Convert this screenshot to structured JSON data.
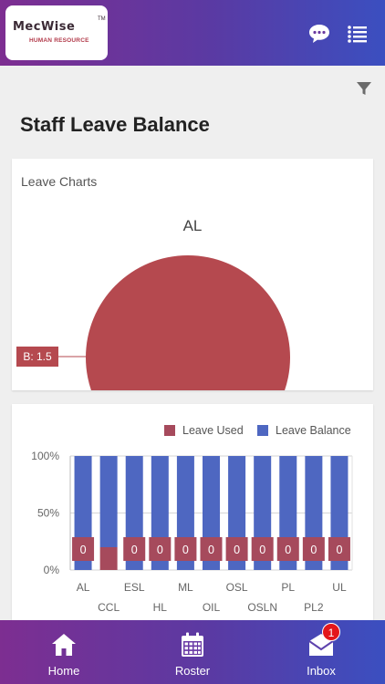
{
  "header": {
    "logo_name": "MecWise",
    "logo_tm": "TM",
    "logo_subtitle": "HUMAN RESOURCE",
    "chat_icon": "chat-bubble-icon",
    "menu_icon": "list-menu-icon"
  },
  "toolbar": {
    "filter_icon": "filter-icon"
  },
  "page_title": "Staff Leave Balance",
  "leave_charts_card": {
    "title": "Leave Charts"
  },
  "chart_data": [
    {
      "type": "pie",
      "title": "AL",
      "slices": [
        {
          "label": "B",
          "value": 1.5,
          "color": "#b5494f"
        }
      ],
      "data_labels": [
        "B: 1.5"
      ]
    },
    {
      "type": "bar",
      "stacked": "percent",
      "categories": [
        "AL",
        "CCL",
        "ESL",
        "HL",
        "ML",
        "OIL",
        "OSL",
        "OSLN",
        "PL",
        "PL2",
        "UL"
      ],
      "series": [
        {
          "name": "Leave Used",
          "color": "#a64a5c",
          "values": [
            0,
            1,
            0,
            0,
            0,
            0,
            0,
            0,
            0,
            0,
            0
          ]
        },
        {
          "name": "Leave Balance",
          "color": "#4e67c1",
          "values": [
            1,
            4,
            1,
            1,
            1,
            1,
            1,
            1,
            1,
            1,
            1
          ]
        }
      ],
      "data_labels": [
        "0",
        "",
        "0",
        "0",
        "0",
        "0",
        "0",
        "0",
        "0",
        "0",
        "0"
      ],
      "yticks": [
        "0%",
        "50%",
        "100%"
      ],
      "ylim": [
        0,
        100
      ],
      "legend_position": "top-right",
      "grid": true
    }
  ],
  "bottom_nav": {
    "items": [
      {
        "label": "Home",
        "icon": "home-icon"
      },
      {
        "label": "Roster",
        "icon": "calendar-icon"
      },
      {
        "label": "Inbox",
        "icon": "envelope-icon",
        "badge": "1"
      }
    ]
  }
}
